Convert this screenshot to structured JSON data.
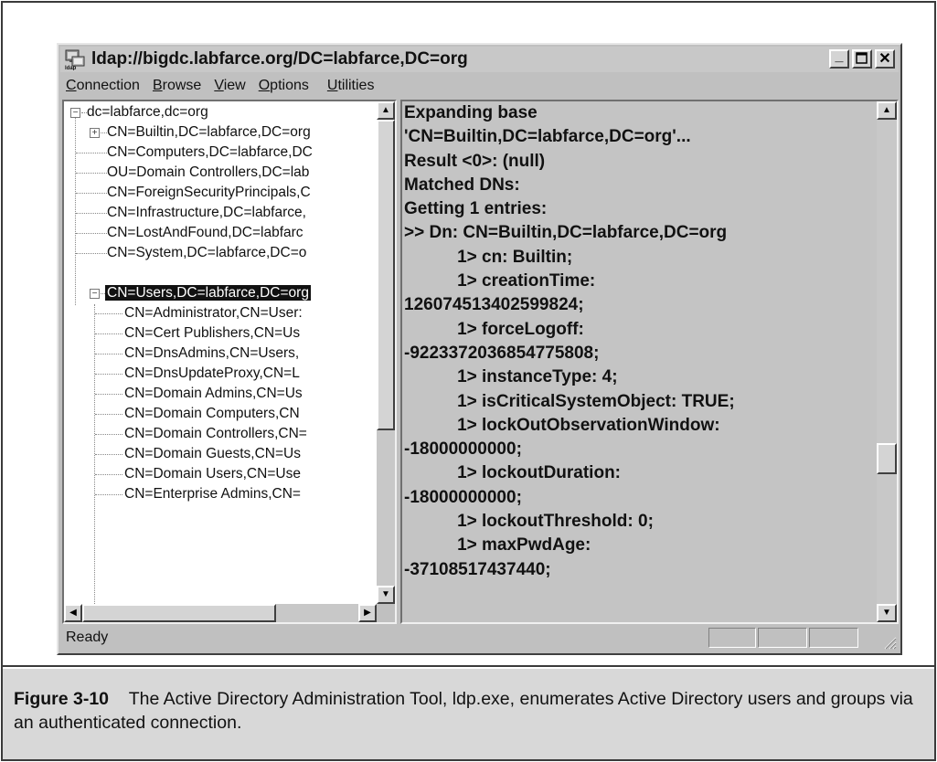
{
  "window": {
    "title": "ldap://bigdc.labfarce.org/DC=labfarce,DC=org",
    "icon_label": "ldap",
    "minimize": "_",
    "close": "✕"
  },
  "menu": [
    {
      "first": "C",
      "rest": "onnection"
    },
    {
      "first": "B",
      "rest": "rowse"
    },
    {
      "first": "V",
      "rest": "iew"
    },
    {
      "first": "O",
      "rest": "ptions"
    },
    {
      "first": "U",
      "rest": "tilities"
    }
  ],
  "tree": {
    "root": "dc=labfarce,dc=org",
    "level1": [
      "CN=Builtin,DC=labfarce,DC=org",
      "CN=Computers,DC=labfarce,DC",
      "OU=Domain Controllers,DC=lab",
      "CN=ForeignSecurityPrincipals,C",
      "CN=Infrastructure,DC=labfarce,",
      "CN=LostAndFound,DC=labfarc",
      "CN=System,DC=labfarce,DC=o",
      "CN=Users,DC=labfarce,DC=org"
    ],
    "users_children": [
      "CN=Administrator,CN=User:",
      "CN=Cert Publishers,CN=Us",
      "CN=DnsAdmins,CN=Users,",
      "CN=DnsUpdateProxy,CN=L",
      "CN=Domain Admins,CN=Us",
      "CN=Domain Computers,CN",
      "CN=Domain Controllers,CN=",
      "CN=Domain Guests,CN=Us",
      "CN=Domain Users,CN=Use",
      "CN=Enterprise Admins,CN="
    ],
    "expand_plus": "+",
    "expand_minus": "−"
  },
  "output_lines": [
    "Expanding base",
    "'CN=Builtin,DC=labfarce,DC=org'...",
    "Result <0>: (null)",
    "Matched DNs:",
    "Getting 1 entries:",
    ">> Dn: CN=Builtin,DC=labfarce,DC=org",
    "           1> cn: Builtin;",
    "           1> creationTime:",
    "126074513402599824;",
    "           1> forceLogoff:",
    "-9223372036854775808;",
    "           1> instanceType: 4;",
    "           1> isCriticalSystemObject: TRUE;",
    "           1> lockOutObservationWindow:",
    "-18000000000;",
    "           1> lockoutDuration:",
    "-18000000000;",
    "           1> lockoutThreshold: 0;",
    "           1> maxPwdAge:",
    "-37108517437440;"
  ],
  "scroll_arrows": {
    "up": "▲",
    "down": "▼",
    "left": "◀",
    "right": "▶"
  },
  "status": "Ready",
  "caption": {
    "label": "Figure 3-10",
    "text": "The Active Directory Administration Tool, ldp.exe, enumerates Active Directory users and groups via an authenticated connection."
  }
}
